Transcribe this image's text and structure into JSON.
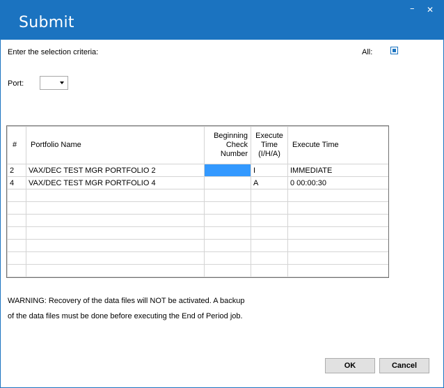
{
  "window": {
    "title": "Submit",
    "minimize_glyph": "–",
    "close_glyph": "✕"
  },
  "criteria": {
    "label": "Enter the selection criteria:",
    "all_label": "All:",
    "all_checked": true,
    "port_label": "Port:",
    "port_value": ""
  },
  "grid": {
    "columns": [
      {
        "label": "#"
      },
      {
        "label": "Portfolio Name"
      },
      {
        "label": "Beginning Check Number"
      },
      {
        "label": "Execute Time (I/H/A)"
      },
      {
        "label": "Execute Time"
      }
    ],
    "rows": [
      {
        "num": "2",
        "name": "VAX/DEC TEST MGR PORTFOLIO 2",
        "check": "",
        "exec_code": "I",
        "exec_time": "IMMEDIATE"
      },
      {
        "num": "4",
        "name": "VAX/DEC TEST MGR PORTFOLIO 4",
        "check": "",
        "exec_code": "A",
        "exec_time": "0 00:00:30"
      }
    ]
  },
  "warning": {
    "line1": "WARNING: Recovery of the data files will NOT be activated.  A backup",
    "line2": "of the data files must be done before executing the End of Period job."
  },
  "buttons": {
    "ok": "OK",
    "cancel": "Cancel"
  },
  "colors": {
    "titlebar": "#1b73c0",
    "selection": "#3399ff"
  }
}
